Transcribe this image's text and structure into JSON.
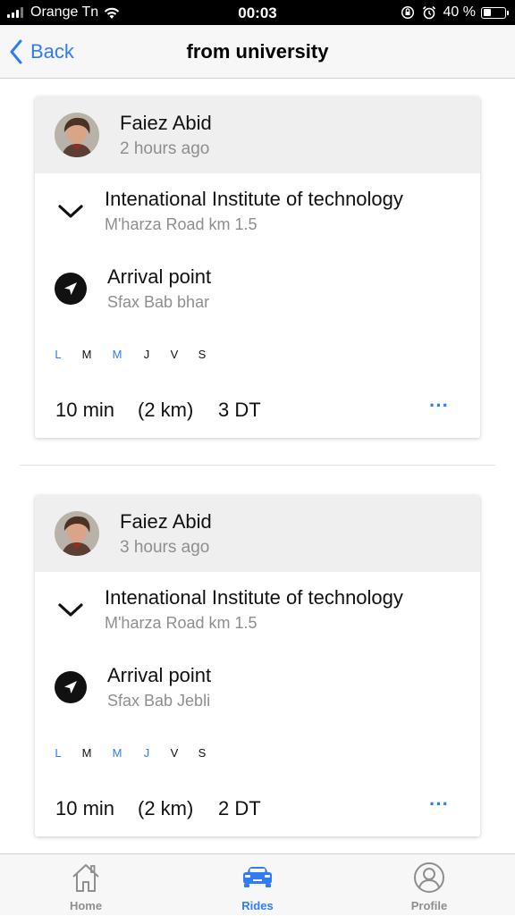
{
  "status_bar": {
    "carrier": "Orange Tn",
    "time": "00:03",
    "battery_pct": "40 %",
    "battery_level": 0.4
  },
  "nav": {
    "back_label": "Back",
    "title": "from university"
  },
  "rides": [
    {
      "driver": "Faiez Abid",
      "posted": "2 hours ago",
      "origin_name": "Intenational Institute of technology",
      "origin_address": "M'harza Road km 1.5",
      "dest_label": "Arrival point",
      "dest_address": "Sfax Bab bhar",
      "days": [
        {
          "label": "L",
          "active": true
        },
        {
          "label": "M",
          "active": false
        },
        {
          "label": "M",
          "active": true
        },
        {
          "label": "J",
          "active": false
        },
        {
          "label": "V",
          "active": false
        },
        {
          "label": "S",
          "active": false
        }
      ],
      "duration": "10 min",
      "distance": "(2 km)",
      "price": "3 DT",
      "more": "···"
    },
    {
      "driver": "Faiez Abid",
      "posted": "3 hours ago",
      "origin_name": "Intenational Institute of technology",
      "origin_address": "M'harza Road km 1.5",
      "dest_label": "Arrival point",
      "dest_address": "Sfax Bab Jebli",
      "days": [
        {
          "label": "L",
          "active": true
        },
        {
          "label": "M",
          "active": false
        },
        {
          "label": "M",
          "active": true
        },
        {
          "label": "J",
          "active": true
        },
        {
          "label": "V",
          "active": false
        },
        {
          "label": "S",
          "active": false
        }
      ],
      "duration": "10 min",
      "distance": "(2 km)",
      "price": "2 DT",
      "more": "···"
    }
  ],
  "tabs": [
    {
      "label": "Home",
      "icon": "home-icon",
      "active": false
    },
    {
      "label": "Rides",
      "icon": "car-icon",
      "active": true
    },
    {
      "label": "Profile",
      "icon": "profile-icon",
      "active": false
    }
  ],
  "colors": {
    "accent": "#2f7cf6",
    "secondary_text": "#8e8e8e",
    "card_header_bg": "#efefef"
  }
}
